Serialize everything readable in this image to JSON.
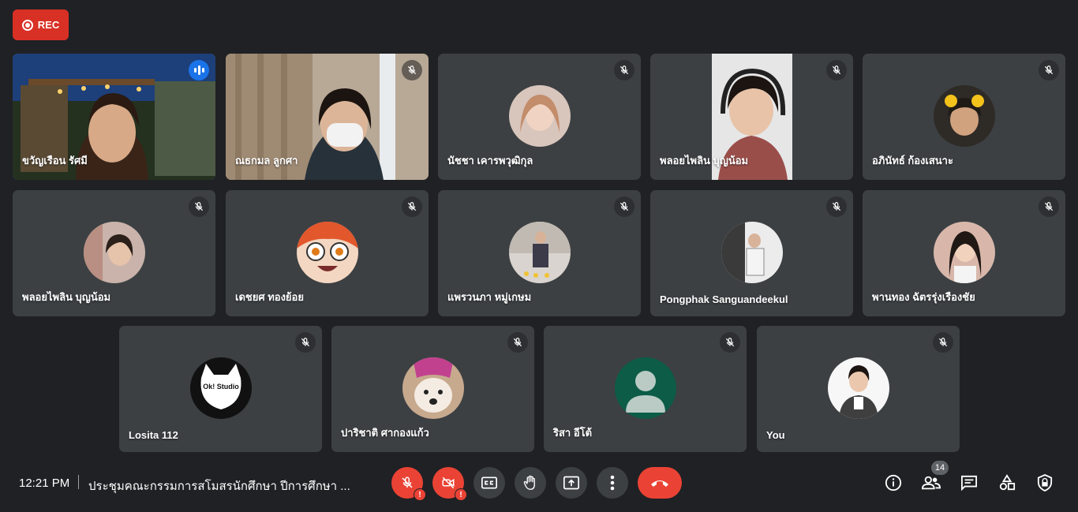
{
  "recording": {
    "label": "REC"
  },
  "participants": [
    {
      "name": "ขวัญเรือน รัศมี"
    },
    {
      "name": "ณธกมล ลูกศา"
    },
    {
      "name": "นัชชา เคารพวุฒิกุล"
    },
    {
      "name": "พลอยไพลิน บุญน้อม"
    },
    {
      "name": "อภินัทธ์ ก้องเสนาะ"
    },
    {
      "name": "พลอยไพลิน บุญน้อม"
    },
    {
      "name": "เดชยศ ทองย้อย"
    },
    {
      "name": "แพรวนภา หมู่เกษม"
    },
    {
      "name": "Pongphak Sanguandeekul"
    },
    {
      "name": "พานทอง ฉัตรรุ่งเรืองชัย"
    },
    {
      "name": "Losita 112"
    },
    {
      "name": "ปาริชาติ ศากองแก้ว"
    },
    {
      "name": "ริสา อีโต้"
    },
    {
      "name": "You"
    }
  ],
  "meeting": {
    "time": "12:21 PM",
    "title": "ประชุมคณะกรรมการสโมสรนักศึกษา ปีการศึกษา ...",
    "participant_count": "14"
  },
  "avatar_logo": {
    "text": "Ok! Studio"
  },
  "colors": {
    "background": "#202124",
    "tile": "#3c4043",
    "danger": "#ea4335",
    "active_speaker": "#8ab4f8"
  }
}
